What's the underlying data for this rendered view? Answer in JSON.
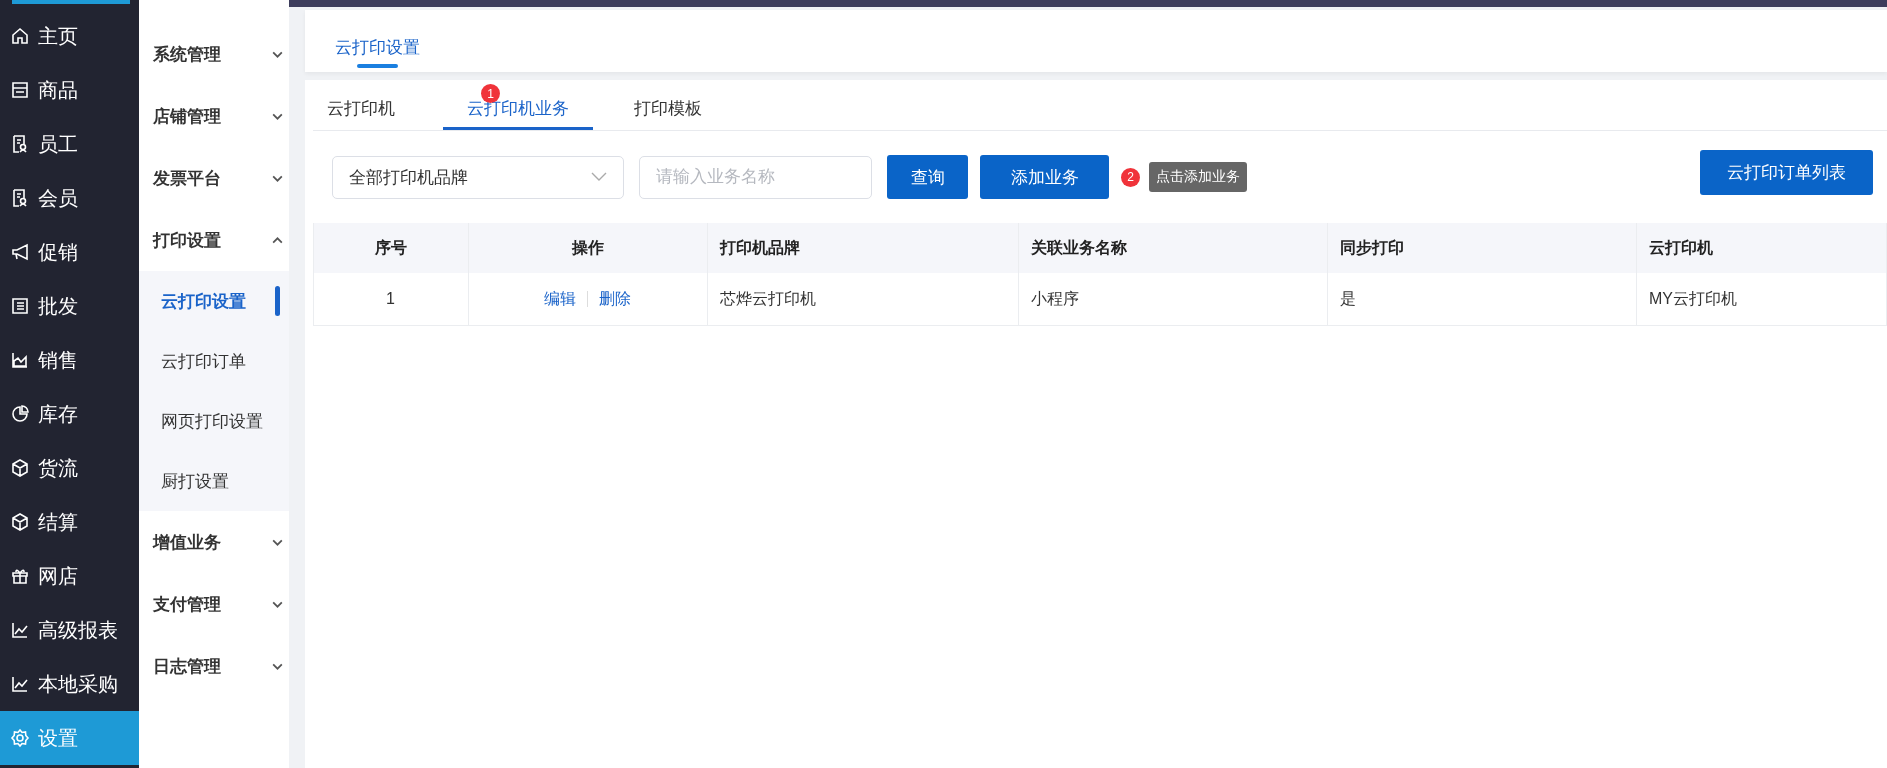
{
  "nav": [
    {
      "label": "主页",
      "kind": "home",
      "selected": false
    },
    {
      "label": "商品",
      "kind": "store",
      "selected": false
    },
    {
      "label": "员工",
      "kind": "idcard",
      "selected": false
    },
    {
      "label": "会员",
      "kind": "idcard",
      "selected": false
    },
    {
      "label": "促销",
      "kind": "megaphone",
      "selected": false
    },
    {
      "label": "批发",
      "kind": "list",
      "selected": false
    },
    {
      "label": "销售",
      "kind": "area",
      "selected": false
    },
    {
      "label": "库存",
      "kind": "pie",
      "selected": false
    },
    {
      "label": "货流",
      "kind": "cube",
      "selected": false
    },
    {
      "label": "结算",
      "kind": "cube",
      "selected": false
    },
    {
      "label": "网店",
      "kind": "gift",
      "selected": false
    },
    {
      "label": "高级报表",
      "kind": "line",
      "selected": false
    },
    {
      "label": "本地采购",
      "kind": "line",
      "selected": false
    },
    {
      "label": "设置",
      "kind": "gear",
      "selected": true
    }
  ],
  "submenu": [
    {
      "label": "系统管理",
      "expanded": false
    },
    {
      "label": "店铺管理",
      "expanded": false
    },
    {
      "label": "发票平台",
      "expanded": false
    },
    {
      "label": "打印设置",
      "expanded": true,
      "children": [
        {
          "label": "云打印设置",
          "selected": true
        },
        {
          "label": "云打印订单",
          "selected": false
        },
        {
          "label": "网页打印设置",
          "selected": false
        },
        {
          "label": "厨打设置",
          "selected": false
        }
      ]
    },
    {
      "label": "增值业务",
      "expanded": false
    },
    {
      "label": "支付管理",
      "expanded": false
    },
    {
      "label": "日志管理",
      "expanded": false
    }
  ],
  "page_tabs": [
    {
      "label": "云打印设置",
      "selected": true
    }
  ],
  "tabs": [
    {
      "label": "云打印机",
      "selected": false
    },
    {
      "label": "云打印机业务",
      "selected": true,
      "badge": "1"
    },
    {
      "label": "打印模板",
      "selected": false
    }
  ],
  "filters": {
    "brand_select": "全部打印机品牌",
    "search": {
      "placeholder": "请输入业务名称"
    },
    "query_button": "查询",
    "add_button": "添加业务",
    "add_badge": "2",
    "tooltip": "点击添加业务",
    "order_list_button": "云打印订单列表"
  },
  "table": {
    "columns": [
      "序号",
      "操作",
      "打印机品牌",
      "关联业务名称",
      "同步打印",
      "云打印机"
    ],
    "rows": [
      {
        "index": "1",
        "actions": [
          "编辑",
          "删除"
        ],
        "brand": "芯烨云打印机",
        "business": "小程序",
        "sync": "是",
        "printer": "MY云打印机"
      }
    ]
  }
}
